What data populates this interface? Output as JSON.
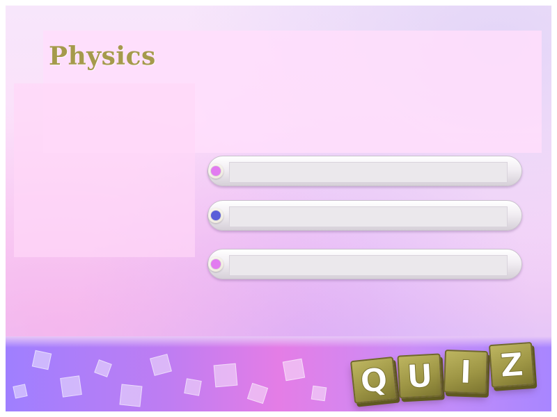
{
  "slide": {
    "title": "Physics",
    "answer_options": [
      {
        "label": "",
        "dot_color": "#e27cf0"
      },
      {
        "label": "",
        "dot_color": "#5a5fd9"
      },
      {
        "label": "",
        "dot_color": "#e27cf0"
      }
    ]
  },
  "quiz_cubes": [
    "Q",
    "U",
    "I",
    "Z"
  ],
  "colors": {
    "title": "#a59a4c",
    "cube": "#a59a4c",
    "band": "#c97df0"
  }
}
